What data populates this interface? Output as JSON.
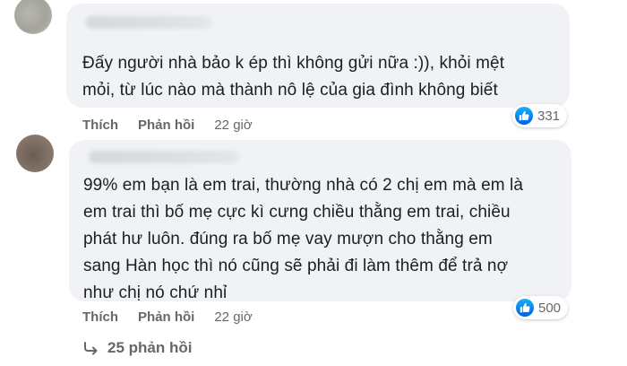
{
  "comments": [
    {
      "text": "Đấy người nhà bảo k ép thì không gửi nữa :)), khỏi mệt\nmỏi, từ lúc nào mà thành nô lệ của gia đình không biết",
      "actions": {
        "like_label": "Thích",
        "reply_label": "Phản hồi",
        "time": "22 giờ"
      },
      "reaction_count": "331",
      "reaction_icon": "like-icon"
    },
    {
      "text": "99% em bạn là em trai, thường nhà có 2 chị em mà em là\nem trai thì bố mẹ cực kì cưng chiều thằng em trai, chiều\nphát hư luôn. đúng ra bố mẹ vay mượn cho thằng em\nsang Hàn học thì nó cũng sẽ phải đi làm thêm để trả nợ\nnhư chị nó chứ nhỉ",
      "actions": {
        "like_label": "Thích",
        "reply_label": "Phản hồi",
        "time": "22 giờ"
      },
      "reaction_count": "500",
      "reaction_icon": "like-icon"
    }
  ],
  "replies": {
    "label": "25 phản hồi",
    "icon": "reply-arrow-icon"
  },
  "colors": {
    "bubble": "#f0f2f5",
    "text": "#1c1e21",
    "secondary": "#65676b",
    "like_blue": "#1877f2"
  }
}
